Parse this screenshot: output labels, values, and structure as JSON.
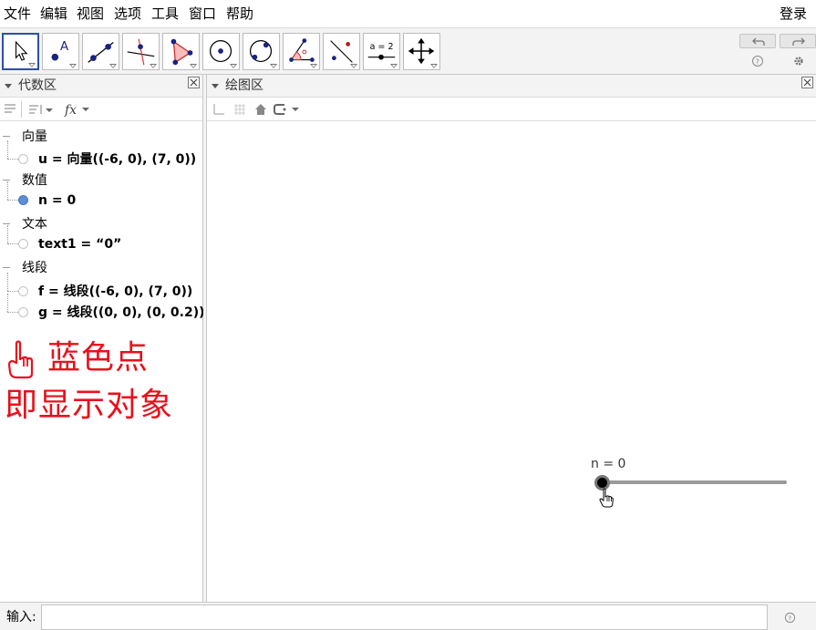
{
  "menu": {
    "items": [
      "文件",
      "编辑",
      "视图",
      "选项",
      "工具",
      "窗口",
      "帮助"
    ],
    "login": "登录"
  },
  "toolbar": {
    "tools": [
      {
        "name": "move-tool",
        "icon": "arrow-pointer-icon"
      },
      {
        "name": "point-tool",
        "icon": "point-a-icon",
        "label": "A"
      },
      {
        "name": "line-tool",
        "icon": "line-through-points-icon"
      },
      {
        "name": "perpendicular-tool",
        "icon": "perpendicular-line-icon"
      },
      {
        "name": "polygon-tool",
        "icon": "polygon-icon"
      },
      {
        "name": "circle-center-tool",
        "icon": "circle-center-icon"
      },
      {
        "name": "circle-points-tool",
        "icon": "circle-three-points-icon"
      },
      {
        "name": "angle-tool",
        "icon": "angle-icon"
      },
      {
        "name": "reflect-tool",
        "icon": "reflect-icon"
      },
      {
        "name": "slider-tool",
        "icon": "slider-icon",
        "label": "a = 2"
      },
      {
        "name": "move-view-tool",
        "icon": "move-view-icon"
      }
    ],
    "accent_color": "#2f4ea8"
  },
  "algebra": {
    "title": "代数区",
    "categories": [
      {
        "label": "向量",
        "items": [
          {
            "text": "u = 向量((-6, 0), (7, 0))",
            "visible": false
          }
        ]
      },
      {
        "label": "数值",
        "items": [
          {
            "text": "n = 0",
            "visible": true
          }
        ]
      },
      {
        "label": "文本",
        "items": [
          {
            "text": "text1 = “0”",
            "visible": false
          }
        ]
      },
      {
        "label": "线段",
        "items": [
          {
            "text": "f = 线段((-6, 0), (7, 0))",
            "visible": false
          },
          {
            "text": "g = 线段((0, 0), (0, 0.2))",
            "visible": false
          }
        ]
      }
    ],
    "annotation": {
      "line1": "蓝色点",
      "line2": "即显示对象",
      "color": "#e8101c"
    }
  },
  "graphics": {
    "title": "绘图区",
    "slider": {
      "label": "n = 0",
      "value": 0
    }
  },
  "input": {
    "label": "输入:",
    "value": "",
    "placeholder": ""
  },
  "colors": {
    "visible_dot": "#5b8dd9",
    "panel_bg": "#f3f3f3"
  }
}
